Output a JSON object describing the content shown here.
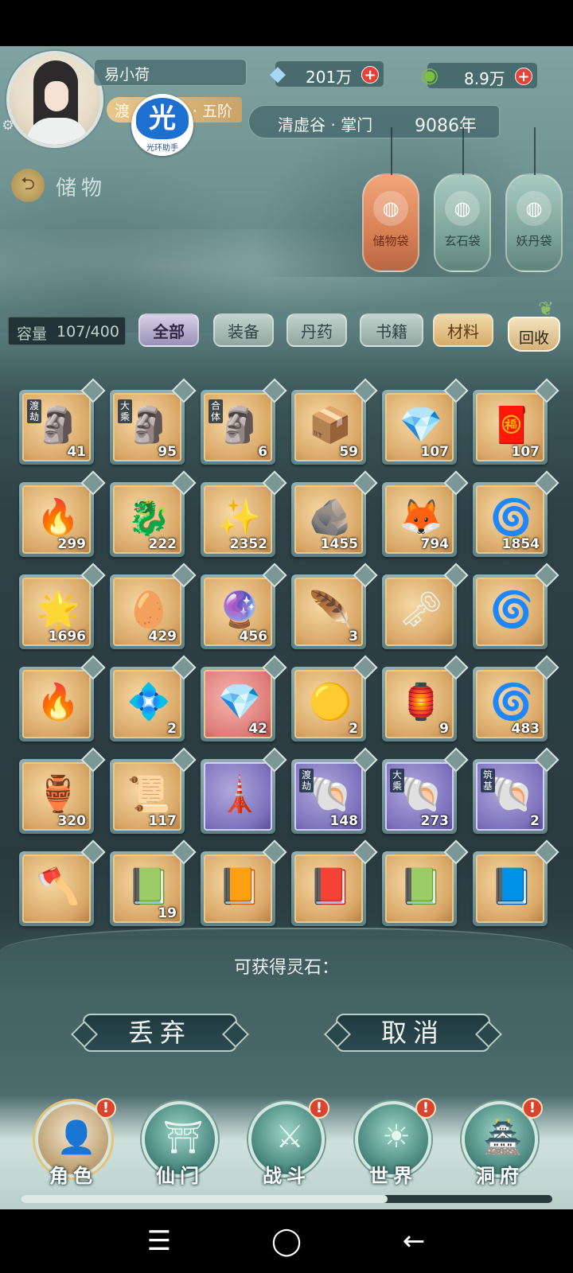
{
  "player": {
    "name": "易小荷",
    "rank_left": "渡",
    "rank_right": "· 五阶",
    "badge_glyph": "光",
    "badge_label": "光环助手"
  },
  "resources": [
    {
      "icon": "spirit-crystal-icon",
      "glyph": "◆",
      "value": "201万",
      "plus": "+"
    },
    {
      "icon": "jade-coin-icon",
      "glyph": "◉",
      "value": "8.9万",
      "plus": "+"
    }
  ],
  "sect": {
    "text": "清虚谷 · 掌门",
    "year": "9086年"
  },
  "page": {
    "back_glyph": "⮌",
    "title": "储物"
  },
  "lanterns": [
    {
      "label": "储物袋",
      "glyph": "◍"
    },
    {
      "label": "玄石袋",
      "glyph": "◍"
    },
    {
      "label": "妖丹袋",
      "glyph": "◍"
    }
  ],
  "capacity": {
    "label": "容量",
    "value": "107/400"
  },
  "tabs": {
    "all": "全部",
    "items": [
      "装备",
      "丹药",
      "书籍",
      "材料"
    ],
    "recycle": "回收"
  },
  "grid": [
    {
      "tier": "渡劫",
      "glyph": "🗿",
      "count": "41",
      "quality": "gold"
    },
    {
      "tier": "大乘",
      "glyph": "🗿",
      "count": "95",
      "quality": "gold"
    },
    {
      "tier": "合体",
      "glyph": "🗿",
      "count": "6",
      "quality": "gold"
    },
    {
      "tier": "",
      "glyph": "📦",
      "count": "59",
      "quality": "gold"
    },
    {
      "tier": "",
      "glyph": "💎",
      "count": "107",
      "quality": "gold"
    },
    {
      "tier": "",
      "glyph": "🧧",
      "count": "107",
      "quality": "gold"
    },
    {
      "tier": "",
      "glyph": "🔥",
      "count": "299",
      "quality": "gold"
    },
    {
      "tier": "",
      "glyph": "🐉",
      "count": "222",
      "quality": "gold"
    },
    {
      "tier": "",
      "glyph": "✨",
      "count": "2352",
      "quality": "gold"
    },
    {
      "tier": "",
      "glyph": "🪨",
      "count": "1455",
      "quality": "gold"
    },
    {
      "tier": "",
      "glyph": "🦊",
      "count": "794",
      "quality": "gold"
    },
    {
      "tier": "",
      "glyph": "🌀",
      "count": "1854",
      "quality": "gold"
    },
    {
      "tier": "",
      "glyph": "🌟",
      "count": "1696",
      "quality": "gold"
    },
    {
      "tier": "",
      "glyph": "🥚",
      "count": "429",
      "quality": "gold"
    },
    {
      "tier": "",
      "glyph": "🔮",
      "count": "456",
      "quality": "gold"
    },
    {
      "tier": "",
      "glyph": "🪶",
      "count": "3",
      "quality": "gold"
    },
    {
      "tier": "",
      "glyph": "🗝",
      "count": "",
      "quality": "gold"
    },
    {
      "tier": "",
      "glyph": "🌀",
      "count": "",
      "quality": "gold"
    },
    {
      "tier": "",
      "glyph": "🔥",
      "count": "",
      "quality": "gold"
    },
    {
      "tier": "",
      "glyph": "💠",
      "count": "2",
      "quality": "gold"
    },
    {
      "tier": "",
      "glyph": "💎",
      "count": "42",
      "quality": "red"
    },
    {
      "tier": "",
      "glyph": "🟡",
      "count": "2",
      "quality": "gold"
    },
    {
      "tier": "",
      "glyph": "🏮",
      "count": "9",
      "quality": "gold"
    },
    {
      "tier": "",
      "glyph": "🌀",
      "count": "483",
      "quality": "gold"
    },
    {
      "tier": "",
      "glyph": "🏺",
      "count": "320",
      "quality": "gold"
    },
    {
      "tier": "",
      "glyph": "📜",
      "count": "117",
      "quality": "gold"
    },
    {
      "tier": "",
      "glyph": "🗼",
      "count": "",
      "quality": "purple"
    },
    {
      "tier": "渡劫",
      "glyph": "🐚",
      "count": "148",
      "quality": "purple"
    },
    {
      "tier": "大乘",
      "glyph": "🐚",
      "count": "273",
      "quality": "purple"
    },
    {
      "tier": "筑基",
      "glyph": "🐚",
      "count": "2",
      "quality": "purple"
    },
    {
      "tier": "",
      "glyph": "🪓",
      "count": "",
      "quality": "gold"
    },
    {
      "tier": "",
      "glyph": "📗",
      "count": "19",
      "quality": "gold"
    },
    {
      "tier": "",
      "glyph": "📙",
      "count": "",
      "quality": "gold"
    },
    {
      "tier": "",
      "glyph": "📕",
      "count": "",
      "quality": "gold"
    },
    {
      "tier": "",
      "glyph": "📗",
      "count": "",
      "quality": "gold"
    },
    {
      "tier": "",
      "glyph": "📘",
      "count": "",
      "quality": "gold"
    }
  ],
  "recycle_panel": {
    "hint": "可获得灵石：",
    "discard": "丢弃",
    "cancel": "取消"
  },
  "nav": [
    {
      "label": "角色",
      "glyph": "👤",
      "alert": "!"
    },
    {
      "label": "仙门",
      "glyph": "⛩",
      "alert": ""
    },
    {
      "label": "战斗",
      "glyph": "⚔",
      "alert": "!"
    },
    {
      "label": "世界",
      "glyph": "☀",
      "alert": "!"
    },
    {
      "label": "洞府",
      "glyph": "🏯",
      "alert": "!"
    }
  ],
  "scroll_progress": 0.69,
  "system_nav": {
    "menu": "☰",
    "home": "◯",
    "back": "←"
  }
}
